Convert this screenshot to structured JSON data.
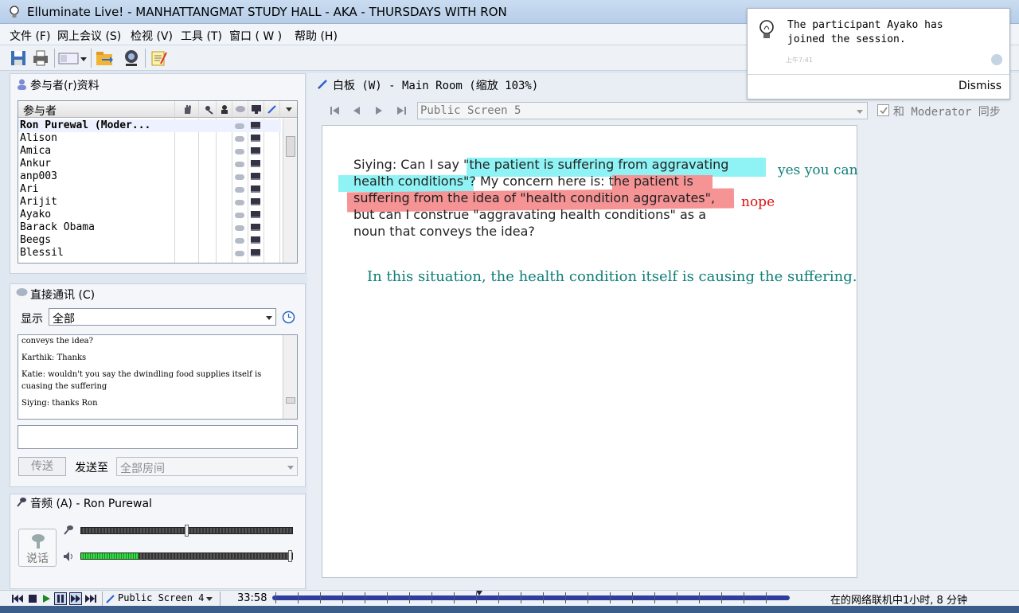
{
  "window": {
    "title": "Elluminate Live! - MANHATTANGMAT STUDY HALL - AKA - THURSDAYS WITH RON"
  },
  "menu": [
    {
      "label": "文件 (F)"
    },
    {
      "label": "网上会议 (S)"
    },
    {
      "label": "检视 (V)"
    },
    {
      "label": "工具 (T)"
    },
    {
      "label": "窗口 ( W )"
    },
    {
      "label": "帮助 (H)"
    }
  ],
  "participants": {
    "title": "参与者(r)资料",
    "column_header": "参与者",
    "rows": [
      "Ron Purewal (Moder...",
      "Alison",
      "Amica",
      "Ankur",
      "anp003",
      "Ari",
      "Arijit",
      "Ayako",
      "Barack Obama",
      "Beegs",
      "Blessil"
    ]
  },
  "chat": {
    "title": "直接通讯 (C)",
    "show_label": "显示",
    "show_value": "全部",
    "lines": [
      "conveys the idea?",
      "Karthik: Thanks",
      "Katie: wouldn't you say the dwindling food supplies itself is cuasing the suffering",
      "Siying: thanks Ron"
    ],
    "send_button": "传送",
    "send_to_label": "发送至",
    "send_to_value": "全部房间",
    "input_value": ""
  },
  "audio": {
    "title": "音频 (A) - Ron Purewal",
    "talk_button": "说话",
    "mic_level": 0.49,
    "speaker_level": 0.27
  },
  "whiteboard": {
    "title": "白板 (W) - Main Room (缩放 103%)",
    "screen_select": "Public Screen 5",
    "sync_label": "和 Moderator 同步",
    "sync_checked": true,
    "lines": [
      "Siying: Can I say \"the patient is suffering from aggravating",
      "health conditions\"? My concern here is: the patient is",
      "suffering from the idea of \"health condition aggravates\",",
      "but can I construe \"aggravating health conditions\" as a",
      "noun that conveys the idea?"
    ],
    "annotation_yes": "yes you can",
    "annotation_nope": "nope",
    "annotation_main": "In this situation, the health condition itself is causing the suffering.",
    "color_cyan": "#8ff3f5",
    "color_red": "#f59395",
    "color_teal": "#0f7f7a",
    "color_nope": "#e01010"
  },
  "notification": {
    "message": "The participant Ayako has joined the session.",
    "time": "上午7:41",
    "dismiss": "Dismiss"
  },
  "bottom": {
    "screen_label": "Public Screen 4",
    "time": "33:58",
    "status": "在的网络联机中1小时, 8 分钟"
  }
}
